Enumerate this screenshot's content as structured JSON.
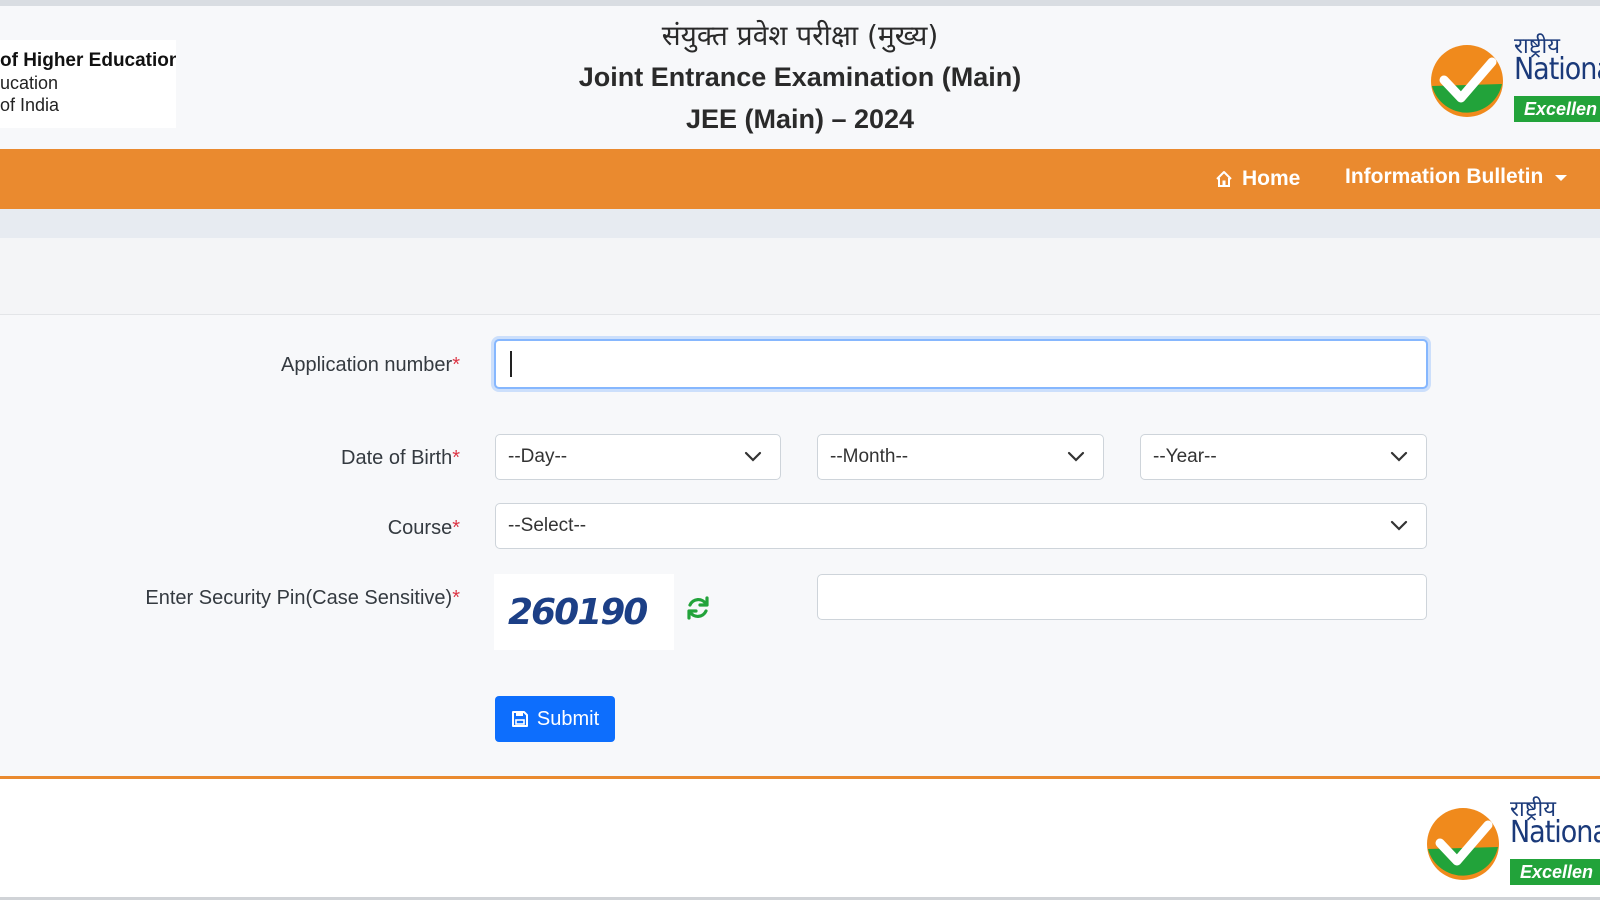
{
  "header": {
    "ministry": {
      "line1": "of Higher Education",
      "line2": "ucation",
      "line3": "of India"
    },
    "title_hindi": "संयुक्त प्रवेश परीक्षा (मुख्य)",
    "title_english": "Joint Entrance Examination (Main)",
    "title_year": "JEE (Main) – 2024",
    "logo": {
      "hindi": "राष्ट्रीय",
      "english": "Nationa",
      "tagline": "Excellen"
    }
  },
  "navbar": {
    "home_label": "Home",
    "bulletin_label": "Information Bulletin"
  },
  "form": {
    "application_number": {
      "label": "Application number",
      "required_mark": "*",
      "value": ""
    },
    "dob": {
      "label": "Date of Birth",
      "required_mark": "*",
      "day": "--Day--",
      "month": "--Month--",
      "year": "--Year--"
    },
    "course": {
      "label": "Course",
      "required_mark": "*",
      "value": "--Select--"
    },
    "security_pin": {
      "label": "Enter Security Pin(Case Sensitive)",
      "required_mark": "*",
      "captcha": "260190",
      "value": ""
    },
    "submit_label": "Submit"
  },
  "footer": {
    "logo": {
      "hindi": "राष्ट्रीय",
      "english": "National",
      "tagline": "Excellen"
    }
  },
  "colors": {
    "navbar": "#ea8a2f",
    "primary_button": "#0d6efd",
    "required": "#dc3545",
    "captcha_text": "#1c3f86",
    "refresh_icon": "#22a33a",
    "logo_green": "#22a33a",
    "logo_orange": "#f08a1c"
  },
  "icons": {
    "home": "home-icon",
    "dropdown": "caret-down-icon",
    "select_chevron": "chevron-down-icon",
    "refresh": "refresh-icon",
    "submit": "floppy-disk-icon",
    "logo_check": "check-circle-icon"
  }
}
